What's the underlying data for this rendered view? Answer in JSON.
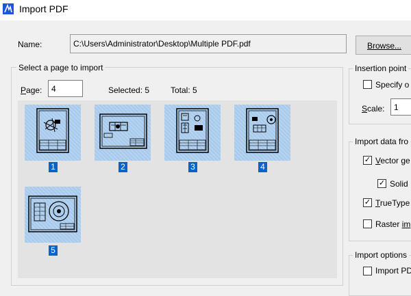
{
  "window": {
    "title": "Import PDF"
  },
  "file": {
    "name_label": "Name:",
    "path": "C:\\Users\\Administrator\\Desktop\\Multiple PDF.pdf",
    "browse_label": "Browse..."
  },
  "page_select": {
    "group_title": "Select a page to import",
    "page_label_prefix": "P",
    "page_label_rest": "age:",
    "page_value": "4",
    "selected_text": "Selected: 5",
    "total_text": "Total: 5",
    "thumbnails": [
      "1",
      "2",
      "3",
      "4",
      "5"
    ],
    "selected_thumbnail": "4"
  },
  "insertion": {
    "group_title": "Insertion point",
    "specify_label": "Specify o",
    "scale_label": "Scale:",
    "scale_value": "1"
  },
  "import_data": {
    "group_title": "Import data fro",
    "vector_label": "Vector ge",
    "vector_checked": true,
    "solid_label": "Solid",
    "solid_checked": true,
    "truetype_label": "TrueType",
    "truetype_checked": true,
    "raster_label": "Raster im",
    "raster_checked": false
  },
  "import_options": {
    "group_title": "Import options",
    "import_label": "Import PD",
    "import_checked": false
  },
  "colors": {
    "accent": "#0a64c8",
    "thumb_bg": "#a6c9ec",
    "thumb_area": "#e3e3e3"
  }
}
